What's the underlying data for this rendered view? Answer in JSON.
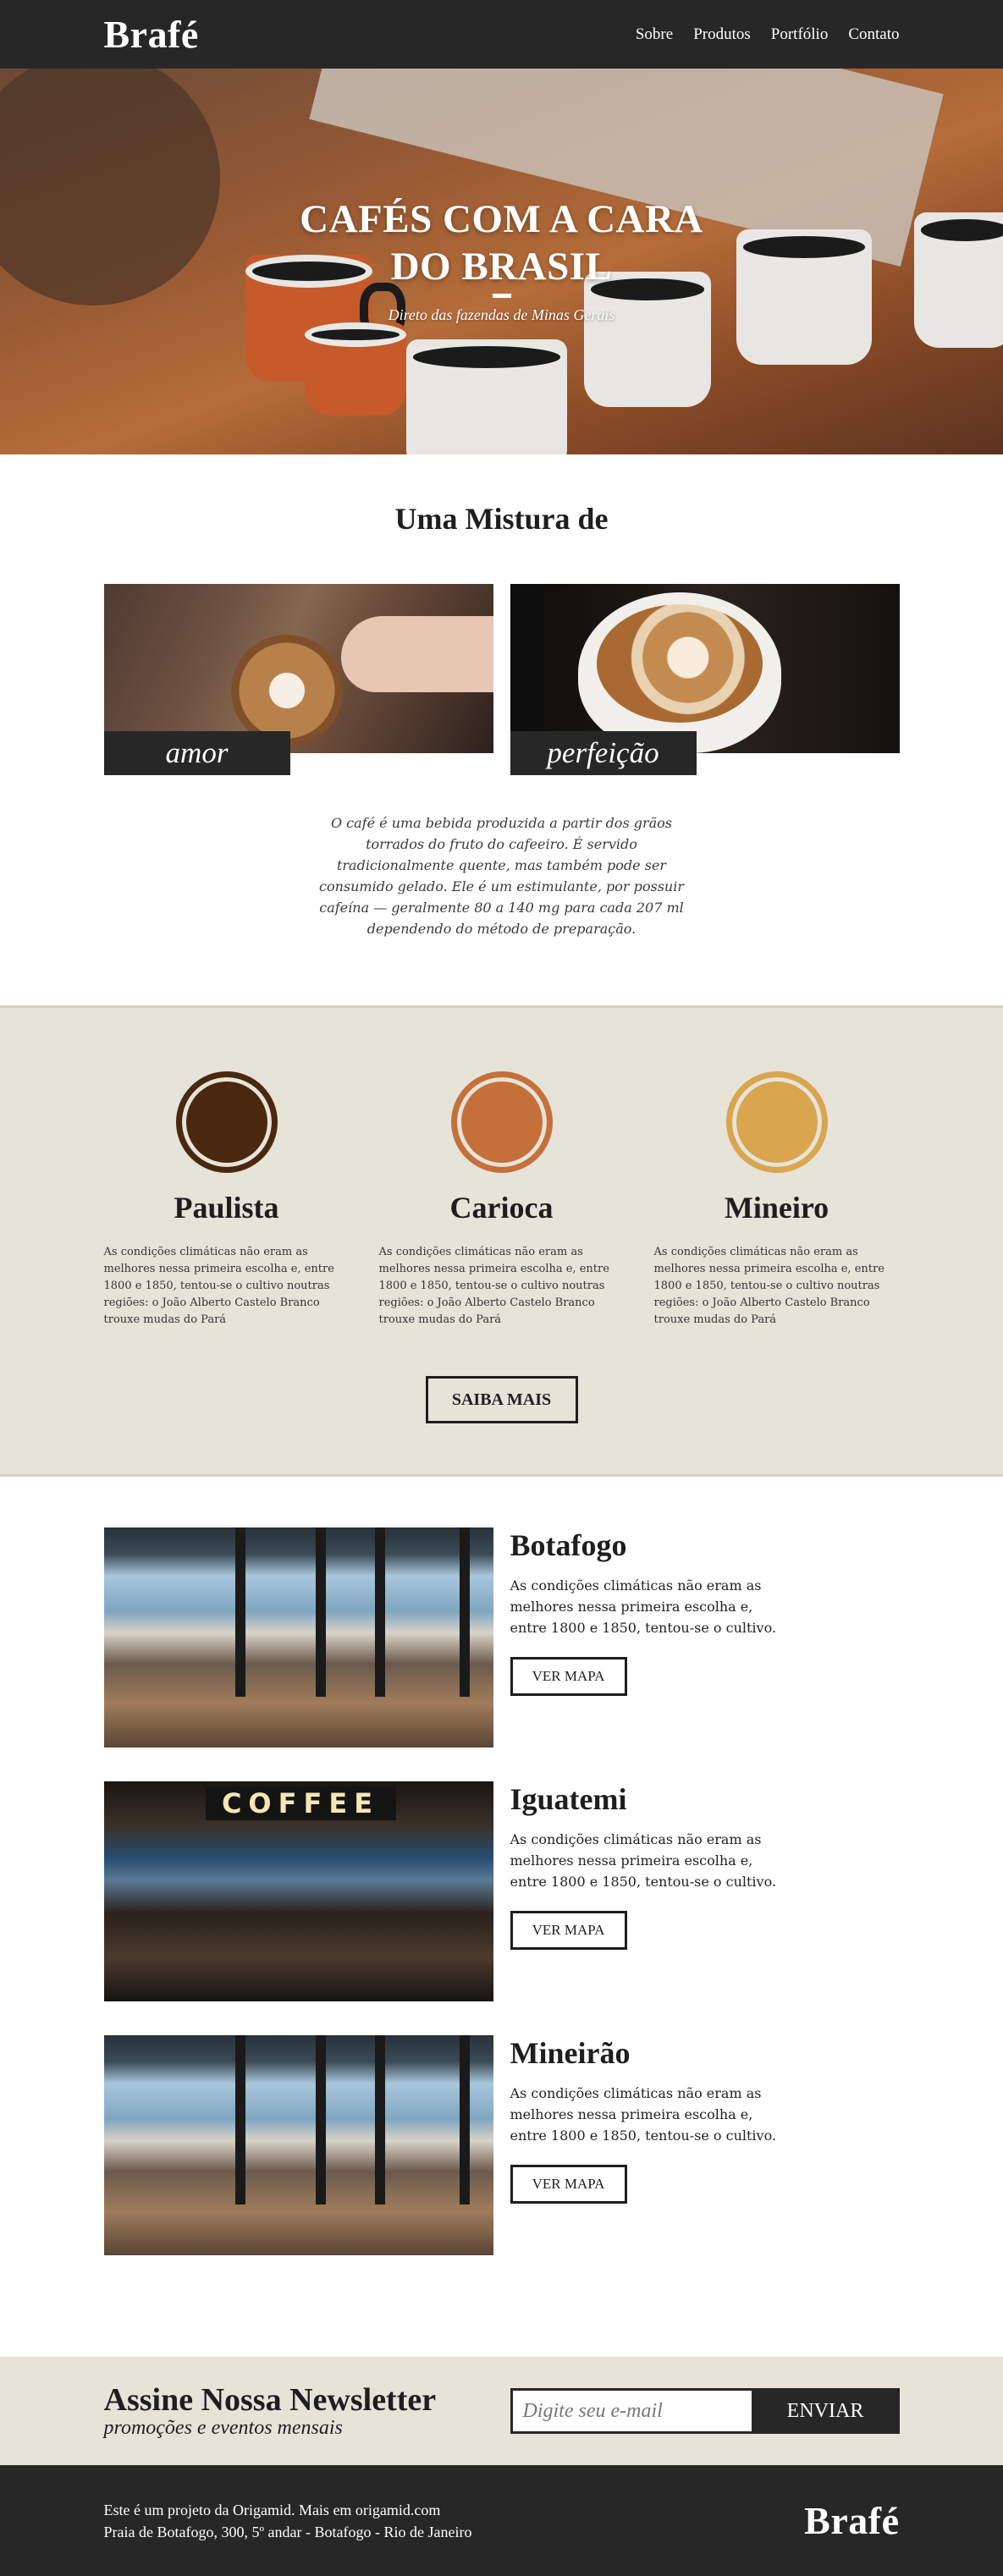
{
  "header": {
    "logo": "Brafé",
    "nav": [
      "Sobre",
      "Produtos",
      "Portfólio",
      "Contato"
    ]
  },
  "hero": {
    "title": "CAFÉS COM A CARA DO BRASIL",
    "subtitle": "Direto das fazendas de Minas Gerais"
  },
  "intro": {
    "title": "Uma Mistura de",
    "photos": [
      {
        "label": "amor",
        "image": "latte-art-heart-photo"
      },
      {
        "label": "perfeição",
        "image": "latte-pour-photo"
      }
    ],
    "text": "O café é uma bebida produzida a partir dos grãos torrados do fruto do cafeeiro. É servido tradicionalmente quente, mas também pode ser consumido gelado. Ele é um estimulante, por possuir cafeína — geralmente 80 a 140 mg para cada 207 ml dependendo do método de preparação."
  },
  "blends": {
    "items": [
      {
        "name": "Paulista",
        "color": "#4a2810",
        "text": "As condições climáticas não eram as melhores nessa primeira escolha e, entre 1800 e 1850, tentou-se o cultivo noutras regiões: o João Alberto Castelo Branco trouxe mudas do Pará"
      },
      {
        "name": "Carioca",
        "color": "#c5703b",
        "text": "As condições climáticas não eram as melhores nessa primeira escolha e, entre 1800 e 1850, tentou-se o cultivo noutras regiões: o João Alberto Castelo Branco trouxe mudas do Pará"
      },
      {
        "name": "Mineiro",
        "color": "#d9a54e",
        "text": "As condições climáticas não eram as melhores nessa primeira escolha e, entre 1800 e 1850, tentou-se o cultivo noutras regiões: o João Alberto Castelo Branco trouxe mudas do Pará"
      }
    ],
    "button": "SAIBA MAIS"
  },
  "locations": {
    "items": [
      {
        "name": "Botafogo",
        "text": "As condições climáticas não eram as melhores nessa primeira escolha e, entre 1800 e 1850, tentou-se o cultivo.",
        "button": "VER MAPA",
        "image": "beach-cafe-photo"
      },
      {
        "name": "Iguatemi",
        "text": "As condições climáticas não eram as melhores nessa primeira escolha e, entre 1800 e 1850, tentou-se o cultivo.",
        "button": "VER MAPA",
        "image": "coffee-shop-photo",
        "sign": "COFFEE"
      },
      {
        "name": "Mineirão",
        "text": "As condições climáticas não eram as melhores nessa primeira escolha e, entre 1800 e 1850, tentou-se o cultivo.",
        "button": "VER MAPA",
        "image": "beach-cafe-photo"
      }
    ]
  },
  "newsletter": {
    "title": "Assine Nossa Newsletter",
    "subtitle": "promoções e eventos mensais",
    "placeholder": "Digite seu e-mail",
    "button": "ENVIAR"
  },
  "footer": {
    "line1": "Este é um projeto da Origamid. Mais em origamid.com",
    "line2": "Praia de Botafogo, 300, 5º andar - Botafogo - Rio de Janeiro",
    "logo": "Brafé"
  },
  "colors": {
    "dark": "#272727",
    "beige": "#e6e3d8"
  }
}
